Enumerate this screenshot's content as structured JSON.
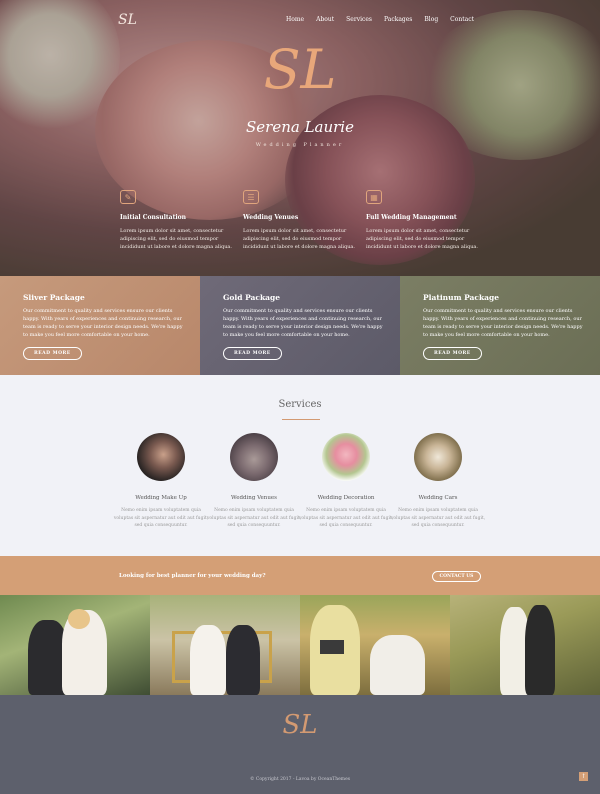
{
  "brand": {
    "logo_small": "SL",
    "logo_big": "SL",
    "name": "Serena Laurie",
    "tagline": "Wedding Planner"
  },
  "nav": {
    "items": [
      "Home",
      "About",
      "Services",
      "Packages",
      "Blog",
      "Contact"
    ]
  },
  "features": [
    {
      "icon": "chat-bubbles-icon",
      "title": "Initial Consultation",
      "text": "Lorem ipsum dolor sit amet, consectetur adipiscing elit, sed do eiusmod tempor incididunt ut labore et dolore magna aliqua."
    },
    {
      "icon": "map-icon",
      "title": "Wedding Venues",
      "text": "Lorem ipsum dolor sit amet, consectetur adipiscing elit, sed do eiusmod tempor incididunt ut labore et dolore magna aliqua."
    },
    {
      "icon": "calendar-icon",
      "title": "Full Wedding Management",
      "text": "Lorem ipsum dolor sit amet, consectetur adipiscing elit, sed do eiusmod tempor incididunt ut labore et dolore magna aliqua."
    }
  ],
  "packages": [
    {
      "title": "Sliver Package",
      "text": "Our commitment to quality and services ensure our clients happy. With years of experiences and continuing research, our team is ready to serve your interior design needs. We're happy to make you feel more comfortable on your home.",
      "button": "READ MORE"
    },
    {
      "title": "Gold Package",
      "text": "Our commitment to quality and services ensure our clients happy. With years of experiences and continuing research, our team is ready to serve your interior design needs. We're happy to make you feel more comfortable on your home.",
      "button": "READ MORE"
    },
    {
      "title": "Platinum Package",
      "text": "Our commitment to quality and services ensure our clients happy. With years of experiences and continuing research, our team is ready to serve your interior design needs. We're happy to make you feel more comfortable on your home.",
      "button": "READ MORE"
    }
  ],
  "services": {
    "title": "Services",
    "items": [
      {
        "title": "Wedding Make Up",
        "text": "Nemo enim ipsam voluptatem quia voluptas sit aspernatur aut odit aut fugit, sed quia consequuntur."
      },
      {
        "title": "Wedding Venues",
        "text": "Nemo enim ipsam voluptatem quia voluptas sit aspernatur aut odit aut fugit, sed quia consequuntur."
      },
      {
        "title": "Wedding Decoration",
        "text": "Nemo enim ipsam voluptatem quia voluptas sit aspernatur aut odit aut fugit, sed quia consequuntur."
      },
      {
        "title": "Wedding Cars",
        "text": "Nemo enim ipsam voluptatem quia voluptas sit aspernatur aut odit aut fugit, sed quia consequuntur."
      }
    ]
  },
  "cta": {
    "text": "Looking for best planner for your wedding day?",
    "button": "CONTACT US"
  },
  "footer": {
    "logo": "SL",
    "copyright": "© Copyright 2017 - Lavoa by OceanThemes"
  },
  "colors": {
    "accent": "#d49f76",
    "footer_bg": "#5d606c",
    "services_bg": "#f1f2f7"
  }
}
